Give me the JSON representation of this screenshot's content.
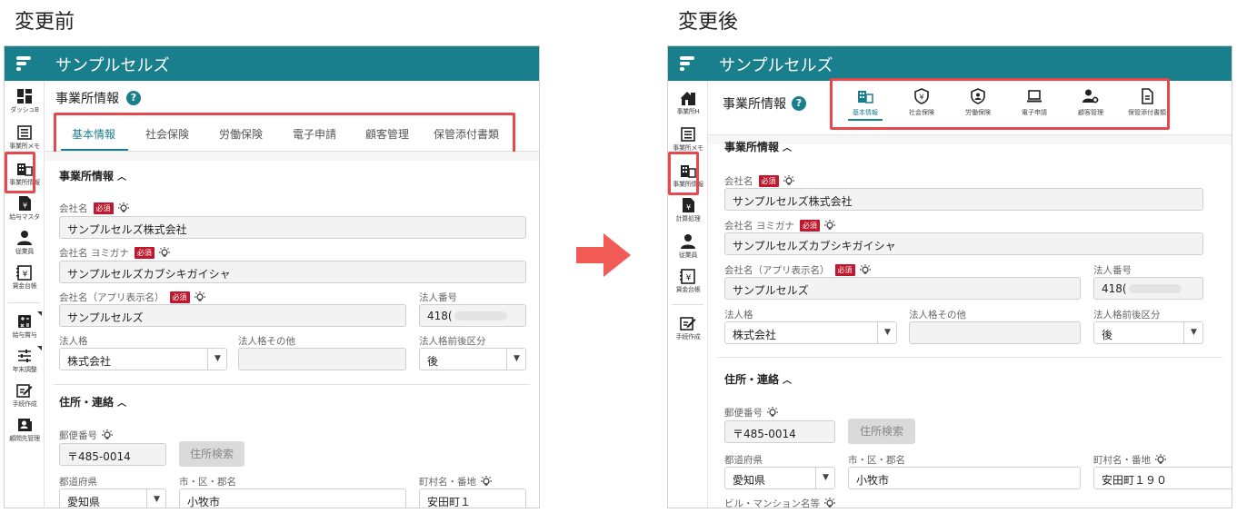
{
  "captions": {
    "before": "変更前",
    "after": "変更後"
  },
  "app": {
    "title": "サンプルセルズ"
  },
  "colors": {
    "brand": "#1a7f8c",
    "highlight": "#e8484c",
    "required": "#c0182e",
    "arrow": "#f15a55"
  },
  "before": {
    "sidebar": [
      {
        "label": "ダッシュB",
        "icon": "dashboard-icon"
      },
      {
        "label": "事業所メモ",
        "icon": "list-icon"
      },
      {
        "label": "事業所情報",
        "icon": "building-icon"
      },
      {
        "label": "給与マスタ",
        "icon": "payslip-icon"
      },
      {
        "label": "従業員",
        "icon": "person-icon"
      },
      {
        "label": "賃金台帳",
        "icon": "ledger-icon"
      },
      {
        "label": "給与賞与",
        "icon": "calculator-icon"
      },
      {
        "label": "年末調整",
        "icon": "sliders-icon"
      },
      {
        "label": "手続作成",
        "icon": "edit-document-icon"
      },
      {
        "label": "顧問先管理",
        "icon": "client-icon"
      }
    ],
    "section_title": "事業所情報",
    "tabs": [
      "基本情報",
      "社会保険",
      "労働保険",
      "電子申請",
      "顧客管理",
      "保管添付書類"
    ],
    "group1": "事業所情報",
    "group2": "住所・連絡",
    "fields": {
      "company_name_label": "会社名",
      "company_name": "サンプルセルズ株式会社",
      "kana_label": "会社名 ヨミガナ",
      "kana": "サンプルセルズカブシキガイシャ",
      "app_name_label": "会社名（アプリ表示名）",
      "app_name": "サンプルセルズ",
      "corp_no_label": "法人番号",
      "corp_no": "418(",
      "legal_form_label": "法人格",
      "legal_form": "株式会社",
      "legal_other_label": "法人格その他",
      "legal_pos_label": "法人格前後区分",
      "legal_pos": "後",
      "postal_label": "郵便番号",
      "postal": "〒485-0014",
      "address_search": "住所検索",
      "pref_label": "都道府県",
      "pref": "愛知県",
      "city_label": "市・区・郡名",
      "city": "小牧市",
      "town_label": "町村名・番地",
      "town": "安田町１"
    },
    "required_badge": "必須"
  },
  "after": {
    "sidebar": [
      {
        "label": "事業所H",
        "icon": "home-building-icon"
      },
      {
        "label": "事業所メモ",
        "icon": "list-icon"
      },
      {
        "label": "事業所情報",
        "icon": "building-icon"
      },
      {
        "label": "計算処理",
        "icon": "payslip-icon"
      },
      {
        "label": "従業員",
        "icon": "person-icon"
      },
      {
        "label": "賃金台帳",
        "icon": "ledger-icon"
      },
      {
        "label": "手続作成",
        "icon": "edit-document-icon"
      }
    ],
    "section_title": "事業所情報",
    "icon_tabs": [
      {
        "label": "基本情報",
        "icon": "building-icon"
      },
      {
        "label": "社会保険",
        "icon": "shield-yen-icon"
      },
      {
        "label": "労働保険",
        "icon": "shield-person-icon"
      },
      {
        "label": "電子申請",
        "icon": "laptop-icon"
      },
      {
        "label": "顧客管理",
        "icon": "person-gear-icon"
      },
      {
        "label": "保管添付書類",
        "icon": "document-icon"
      }
    ],
    "group1": "事業所情報",
    "group2": "住所・連絡",
    "fields": {
      "company_name_label": "会社名",
      "company_name": "サンプルセルズ株式会社",
      "kana_label": "会社名 ヨミガナ",
      "kana": "サンプルセルズカブシキガイシャ",
      "app_name_label": "会社名（アプリ表示名）",
      "app_name": "サンプルセルズ",
      "corp_no_label": "法人番号",
      "corp_no": "418(",
      "legal_form_label": "法人格",
      "legal_form": "株式会社",
      "legal_other_label": "法人格その他",
      "legal_pos_label": "法人格前後区分",
      "legal_pos": "後",
      "postal_label": "郵便番号",
      "postal": "〒485-0014",
      "address_search": "住所検索",
      "pref_label": "都道府県",
      "pref": "愛知県",
      "city_label": "市・区・郡名",
      "city": "小牧市",
      "town_label": "町村名・番地",
      "town": "安田町１９０",
      "building_label": "ビル・マンション名等"
    },
    "required_badge": "必須"
  }
}
